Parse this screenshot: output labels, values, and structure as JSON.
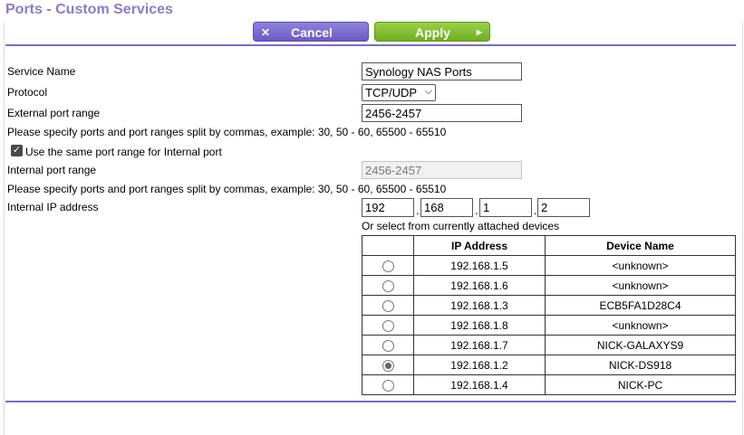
{
  "page": {
    "title": "Ports - Custom Services"
  },
  "buttons": {
    "cancel_label": "Cancel",
    "apply_label": "Apply"
  },
  "icons": {
    "cancel": "✕",
    "apply": "▶"
  },
  "form": {
    "service_name_label": "Service Name",
    "service_name_value": "Synology NAS Ports",
    "protocol_label": "Protocol",
    "protocol_value": "TCP/UDP",
    "external_port_label": "External port range",
    "external_port_value": "2456-2457",
    "hint_text": "Please specify ports and port ranges split by commas, example: 30, 50 - 60, 65500 - 65510",
    "same_port_checkbox_label": "Use the same port range for Internal port",
    "same_port_checked": true,
    "internal_port_label": "Internal port range",
    "internal_port_value": "2456-2457",
    "internal_ip_label": "Internal IP address",
    "ip_octets": [
      "192",
      "168",
      "1",
      "2"
    ],
    "select_devices_label": "Or select from currently attached devices"
  },
  "devices_table": {
    "headers": [
      "",
      "IP Address",
      "Device Name"
    ],
    "rows": [
      {
        "ip": "192.168.1.5",
        "name": "<unknown>",
        "selected": false
      },
      {
        "ip": "192.168.1.6",
        "name": "<unknown>",
        "selected": false
      },
      {
        "ip": "192.168.1.3",
        "name": "ECB5FA1D28C4",
        "selected": false
      },
      {
        "ip": "192.168.1.8",
        "name": "<unknown>",
        "selected": false
      },
      {
        "ip": "192.168.1.7",
        "name": "NICK-GALAXYS9",
        "selected": false
      },
      {
        "ip": "192.168.1.2",
        "name": "NICK-DS918",
        "selected": true
      },
      {
        "ip": "192.168.1.4",
        "name": "NICK-PC",
        "selected": false
      }
    ]
  },
  "colors": {
    "title": "#8a7ad0",
    "cancel_button": "#7b6dd1",
    "apply_button": "#84c035",
    "divider": "#7a6cc8"
  }
}
